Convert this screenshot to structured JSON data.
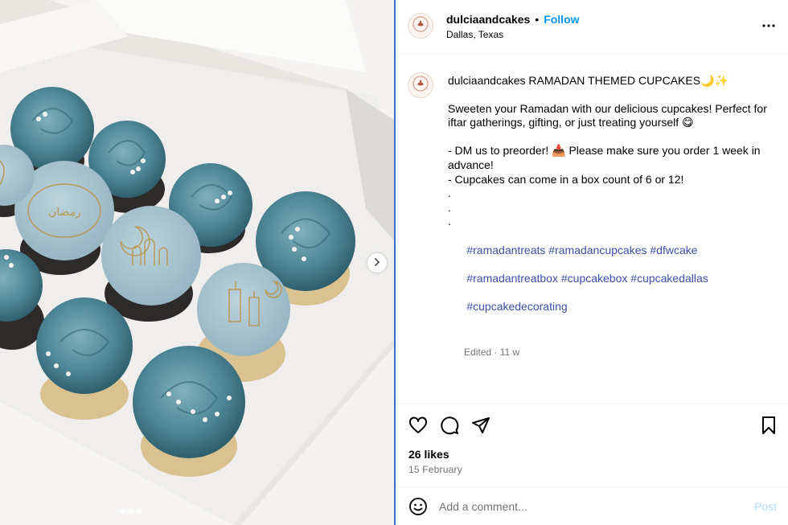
{
  "post": {
    "username": "dulciaandcakes",
    "follow_label": "Follow",
    "separator": "•",
    "location": "Dallas, Texas",
    "more_icon": "more-horizontal-icon",
    "avatar_icon": "bakery-logo-icon"
  },
  "caption": {
    "username": "dulciaandcakes",
    "title": " RAMADAN THEMED CUPCAKES🌙✨",
    "body": "Sweeten your Ramadan with our delicious cupcakes! Perfect for iftar gatherings, gifting, or just treating yourself 😋\n\n- DM us to preorder! 📥 Please make sure you order 1 week in advance!\n- Cupcakes can come in a box count of 6 or 12!\n.\n.\n.",
    "hashtags": [
      "#ramadantreats",
      "#ramadancupcakes",
      "#dfwcake",
      "#ramadantreatbox",
      "#cupcakebox",
      "#cupcakedallas",
      "#cupcakedecorating"
    ],
    "edited_label": "Edited",
    "time_ago": "11 w"
  },
  "actions": {
    "like_icon": "heart-icon",
    "comment_icon": "comment-icon",
    "share_icon": "share-icon",
    "save_icon": "bookmark-icon",
    "likes": "26 likes",
    "date": "15 February"
  },
  "comment": {
    "placeholder": "Add a comment...",
    "post_label": "Post",
    "emoji_icon": "emoji-icon"
  },
  "carousel": {
    "next_icon": "chevron-right-icon",
    "slide_count": 3,
    "active_slide": 1
  },
  "colors": {
    "follow": "#0095f6",
    "hashtag": "#3a4fa8",
    "post_disabled": "#b3dbff",
    "cupcake_teal": "#4e8a9a",
    "fondant": "#a9c4cf"
  }
}
